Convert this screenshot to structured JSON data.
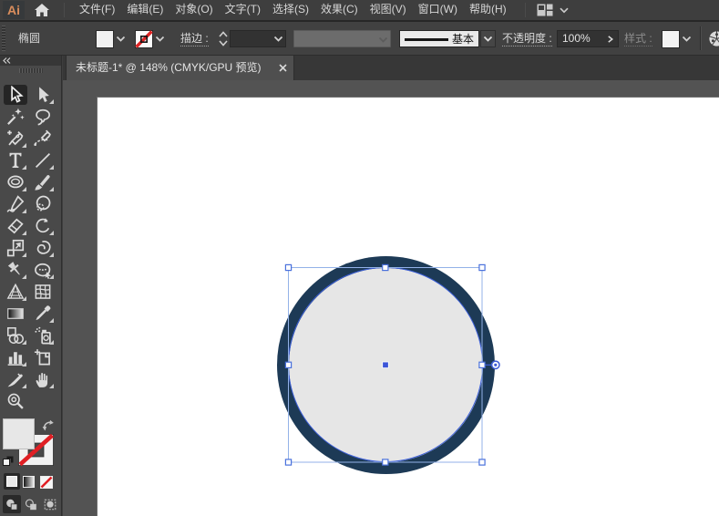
{
  "app": {
    "logo_text": "Ai"
  },
  "menubar": {
    "items": [
      {
        "label": "文件(F)"
      },
      {
        "label": "编辑(E)"
      },
      {
        "label": "对象(O)"
      },
      {
        "label": "文字(T)"
      },
      {
        "label": "选择(S)"
      },
      {
        "label": "效果(C)"
      },
      {
        "label": "视图(V)"
      },
      {
        "label": "窗口(W)"
      },
      {
        "label": "帮助(H)"
      }
    ],
    "icons": [
      "home-icon",
      "workspace-switcher-icon"
    ]
  },
  "controlbar": {
    "context_label": "椭圆",
    "stroke_label": "描边 :",
    "brush_value": "基本",
    "opacity_label": "不透明度 :",
    "opacity_value": "100%",
    "style_label": "样式 :"
  },
  "document_tab": {
    "title": "未标题-1* @ 148% (CMYK/GPU 预览)",
    "close_label": "✕"
  },
  "tools": [
    "selection",
    "direct-selection",
    "magic-wand",
    "lasso",
    "pen",
    "curvature",
    "type",
    "line-segment",
    "ellipse",
    "paintbrush",
    "shaper",
    "blob-brush",
    "eraser",
    "rotate",
    "scale",
    "width",
    "puppet-warp",
    "shape-builder",
    "perspective-grid",
    "mesh",
    "gradient",
    "eyedropper",
    "blend",
    "symbol-sprayer",
    "column-graph",
    "artboard",
    "slice",
    "hand",
    "zoom"
  ],
  "selected_tool": "selection",
  "canvas": {
    "shape": {
      "type": "ellipse",
      "fill_color": "#e6e6e6",
      "stroke_color": "#1d3a56"
    },
    "selection_color": "#3c5fd9",
    "artboard_color": "#ffffff",
    "pasteboard_color": "#535353"
  }
}
